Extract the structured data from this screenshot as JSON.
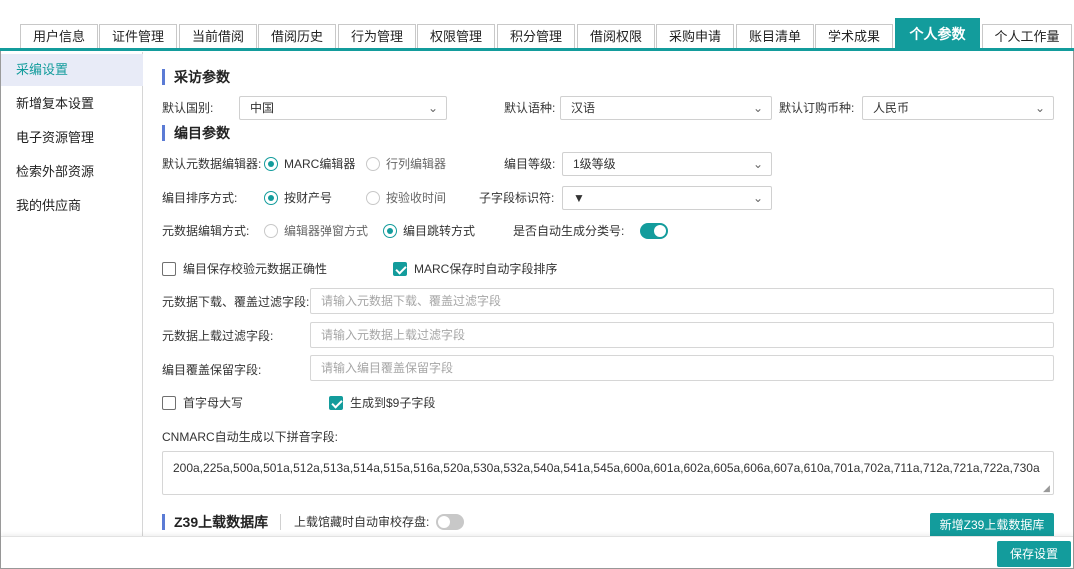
{
  "tabs": [
    {
      "label": "用户信息"
    },
    {
      "label": "证件管理"
    },
    {
      "label": "当前借阅"
    },
    {
      "label": "借阅历史"
    },
    {
      "label": "行为管理"
    },
    {
      "label": "权限管理"
    },
    {
      "label": "积分管理"
    },
    {
      "label": "借阅权限"
    },
    {
      "label": "采购申请"
    },
    {
      "label": "账目清单"
    },
    {
      "label": "学术成果"
    },
    {
      "label": "个人参数"
    },
    {
      "label": "个人工作量"
    }
  ],
  "sidebar": {
    "items": [
      {
        "label": "采编设置"
      },
      {
        "label": "新增复本设置"
      },
      {
        "label": "电子资源管理"
      },
      {
        "label": "检索外部资源"
      },
      {
        "label": "我的供应商"
      }
    ]
  },
  "acquisition": {
    "title": "采访参数",
    "country_label": "默认国别:",
    "country_value": "中国",
    "language_label": "默认语种:",
    "language_value": "汉语",
    "currency_label": "默认订购币种:",
    "currency_value": "人民币"
  },
  "cataloging": {
    "title": "编目参数",
    "editor_label": "默认元数据编辑器:",
    "editor_opt1": "MARC编辑器",
    "editor_opt2": "行列编辑器",
    "level_label": "编目等级:",
    "level_value": "1级等级",
    "sort_label": "编目排序方式:",
    "sort_opt1": "按财产号",
    "sort_opt2": "按验收时间",
    "subfield_label": "子字段标识符:",
    "subfield_value": "▼",
    "editmode_label": "元数据编辑方式:",
    "editmode_opt1": "编辑器弹窗方式",
    "editmode_opt2": "编目跳转方式",
    "autoclass_label": "是否自动生成分类号:",
    "check_validate": "编目保存校验元数据正确性",
    "check_sort": "MARC保存时自动字段排序",
    "download_filter_label": "元数据下载、覆盖过滤字段:",
    "download_filter_placeholder": "请输入元数据下载、覆盖过滤字段",
    "upload_filter_label": "元数据上载过滤字段:",
    "upload_filter_placeholder": "请输入元数据上载过滤字段",
    "keep_label": "编目覆盖保留字段:",
    "keep_placeholder": "请输入编目覆盖保留字段",
    "check_capital": "首字母大写",
    "check_sub9": "生成到$9子字段",
    "pinyin_label": "CNMARC自动生成以下拼音字段:",
    "pinyin_value": "200a,225a,500a,501a,512a,513a,514a,515a,516a,520a,530a,532a,540a,541a,545a,600a,601a,602a,605a,606a,607a,610a,701a,702a,711a,712a,721a,722a,730a"
  },
  "z39": {
    "title": "Z39上载数据库",
    "audit_label": "上载馆藏时自动审校存盘:",
    "add_button": "新增Z39上载数据库"
  },
  "footer": {
    "save_button": "保存设置"
  },
  "colors": {
    "accent": "#139c9c",
    "section_marker": "#5b7bd5",
    "sidebar_active_bg": "#e8ebf7"
  }
}
